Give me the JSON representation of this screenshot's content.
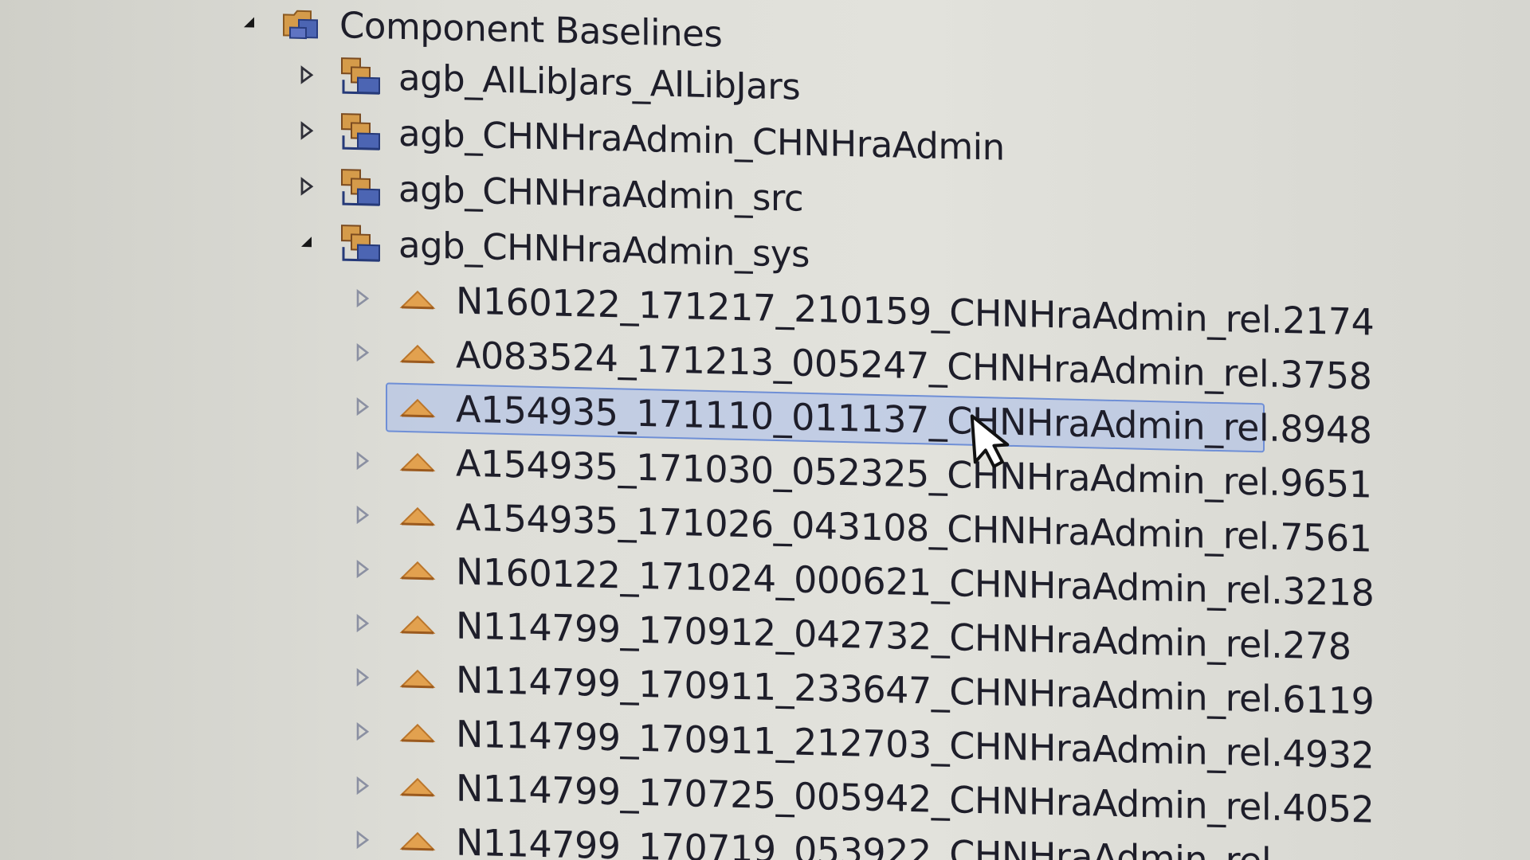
{
  "colors": {
    "background": "#dcdcd6",
    "text": "#1e1e2a",
    "selection_fill": "#b7c7ee",
    "selection_border": "#6f8fd6",
    "folder_icon": "#d59b4a",
    "component_icon": "#4c65b3",
    "baseline_icon": "#e2a14f"
  },
  "tree": {
    "root": {
      "label": "Component Baselines",
      "expanded": true,
      "icon": "component-baselines-folder-icon"
    },
    "components": [
      {
        "label": "agb_AILibJars_AILibJars",
        "expanded": false,
        "icon": "component-icon"
      },
      {
        "label": "agb_CHNHraAdmin_CHNHraAdmin",
        "expanded": false,
        "icon": "component-icon"
      },
      {
        "label": "agb_CHNHraAdmin_src",
        "expanded": false,
        "icon": "component-icon"
      },
      {
        "label": "agb_CHNHraAdmin_sys",
        "expanded": true,
        "icon": "component-icon"
      }
    ],
    "baselines": [
      {
        "label": "N160122_171217_210159_CHNHraAdmin_rel.2174",
        "selected": false
      },
      {
        "label": "A083524_171213_005247_CHNHraAdmin_rel.3758",
        "selected": false
      },
      {
        "label": "A154935_171110_011137_CHNHraAdmin_rel.8948",
        "selected": true
      },
      {
        "label": "A154935_171030_052325_CHNHraAdmin_rel.9651",
        "selected": false
      },
      {
        "label": "A154935_171026_043108_CHNHraAdmin_rel.7561",
        "selected": false
      },
      {
        "label": "N160122_171024_000621_CHNHraAdmin_rel.3218",
        "selected": false
      },
      {
        "label": "N114799_170912_042732_CHNHraAdmin_rel.278",
        "selected": false
      },
      {
        "label": "N114799_170911_233647_CHNHraAdmin_rel.6119",
        "selected": false
      },
      {
        "label": "N114799_170911_212703_CHNHraAdmin_rel.4932",
        "selected": false
      },
      {
        "label": "N114799_170725_005942_CHNHraAdmin_rel.4052",
        "selected": false
      },
      {
        "label": "N114799_170719_053922_CHNHraAdmin_rel.",
        "selected": false
      }
    ]
  }
}
